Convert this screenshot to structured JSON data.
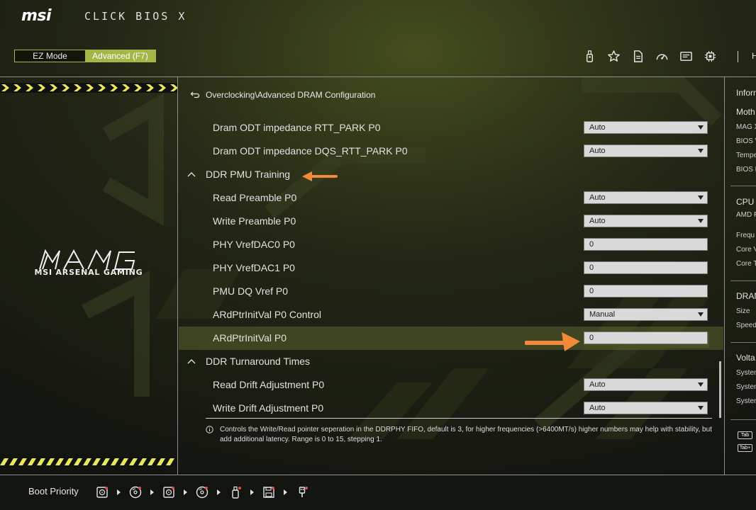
{
  "header": {
    "logo": "msi",
    "brand": "CLICK BIOS X",
    "modes": {
      "ez_label": "EZ Mode",
      "advanced_label": "Advanced (F7)",
      "active": "advanced"
    },
    "icons": [
      "usb-drive-icon",
      "favorites-star-icon",
      "report-document-icon",
      "monitor-gauge-icon",
      "screen-profile-icon",
      "cpu-chip-icon"
    ],
    "tail_text": "H"
  },
  "left_panel": {
    "series_text": "MSI ARSENAL GAMING",
    "logo_icon": "mag-logo-icon"
  },
  "breadcrumb": {
    "path": "Overclocking\\Advanced DRAM Configuration"
  },
  "settings": [
    {
      "kind": "item",
      "label": "Dram ODT impedance RTT_PARK P0",
      "control": "dropdown",
      "value": "Auto"
    },
    {
      "kind": "item",
      "label": "Dram ODT impedance DQS_RTT_PARK P0",
      "control": "dropdown",
      "value": "Auto"
    },
    {
      "kind": "section",
      "label": "DDR PMU Training",
      "expanded": true
    },
    {
      "kind": "item",
      "label": "Read Preamble P0",
      "control": "dropdown",
      "value": "Auto"
    },
    {
      "kind": "item",
      "label": "Write Preamble P0",
      "control": "dropdown",
      "value": "Auto"
    },
    {
      "kind": "item",
      "label": "PHY VrefDAC0 P0",
      "control": "input",
      "value": "0"
    },
    {
      "kind": "item",
      "label": "PHY VrefDAC1 P0",
      "control": "input",
      "value": "0"
    },
    {
      "kind": "item",
      "label": "PMU DQ Vref P0",
      "control": "input",
      "value": "0"
    },
    {
      "kind": "item",
      "label": "ARdPtrInitVal P0 Control",
      "control": "dropdown",
      "value": "Manual"
    },
    {
      "kind": "item",
      "label": "ARdPtrInitVal P0",
      "control": "input",
      "value": "0",
      "selected": true
    },
    {
      "kind": "section",
      "label": "DDR Turnaround Times",
      "expanded": true
    },
    {
      "kind": "item",
      "label": "Read Drift Adjustment P0",
      "control": "dropdown",
      "value": "Auto"
    },
    {
      "kind": "item",
      "label": "Write Drift Adjustment P0",
      "control": "dropdown",
      "value": "Auto"
    }
  ],
  "help": {
    "text": "Controls the Write/Read pointer seperation in the DDRPHY FIFO, default is 3, for higher frequencies (>6400MT/s) higher numbers may help with stability, but add additional latency. Range is 0 to 15, stepping 1."
  },
  "info_panel": {
    "title": "Inform",
    "motherboard": {
      "heading": "Moth",
      "model": "MAG X",
      "lines": [
        "BIOS V",
        "Tempe",
        "BIOS B"
      ]
    },
    "cpu": {
      "heading": "CPU",
      "model": "AMD R",
      "lines": [
        "Frequ",
        "Core V",
        "Core T"
      ]
    },
    "dram": {
      "heading": "DRAM",
      "lines": [
        "Size",
        "Speed"
      ]
    },
    "voltage": {
      "heading": "Volta",
      "lines": [
        "System",
        "System",
        "System"
      ]
    },
    "tab_keys": [
      "Tab",
      "Tab+"
    ]
  },
  "footer": {
    "boot_label": "Boot Priority",
    "boot_devices": [
      "hdd-icon",
      "optical-disc-icon",
      "hdd-icon",
      "optical-disc-icon",
      "usb-key-icon",
      "floppy-icon",
      "usb-plug-icon"
    ]
  },
  "colors": {
    "accent": "#a6b548",
    "annotation_arrow": "#f28a3a",
    "hazard_yellow": "#e8e85a",
    "background": "#141611"
  }
}
